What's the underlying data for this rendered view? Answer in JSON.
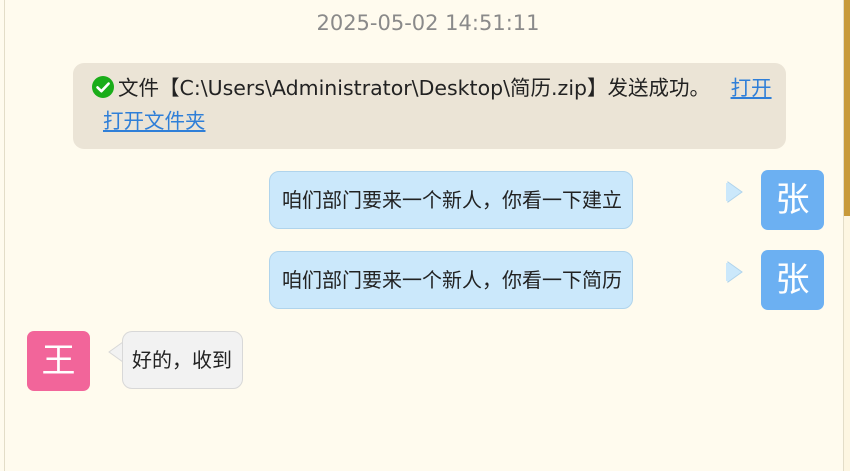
{
  "timestamp": "2025-05-02 14:51:11",
  "notice": {
    "text": "文件【C:\\Users\\Administrator\\Desktop\\简历.zip】发送成功。",
    "open_link": "打开",
    "open_folder_link": "打开文件夹",
    "icon": "check-circle-icon",
    "icon_color": "#1aad19"
  },
  "messages": [
    {
      "direction": "out",
      "avatar": "张",
      "avatar_color": "#6cb0f2",
      "text": "咱们部门要来一个新人，你看一下建立"
    },
    {
      "direction": "out",
      "avatar": "张",
      "avatar_color": "#6cb0f2",
      "text": "咱们部门要来一个新人，你看一下简历"
    },
    {
      "direction": "in",
      "avatar": "王",
      "avatar_color": "#f2659a",
      "text": "好的，收到"
    }
  ],
  "colors": {
    "background": "#fffbee",
    "bubble_out": "#cbe8fb",
    "bubble_in": "#f2f2f2",
    "link": "#2f7fd8"
  }
}
